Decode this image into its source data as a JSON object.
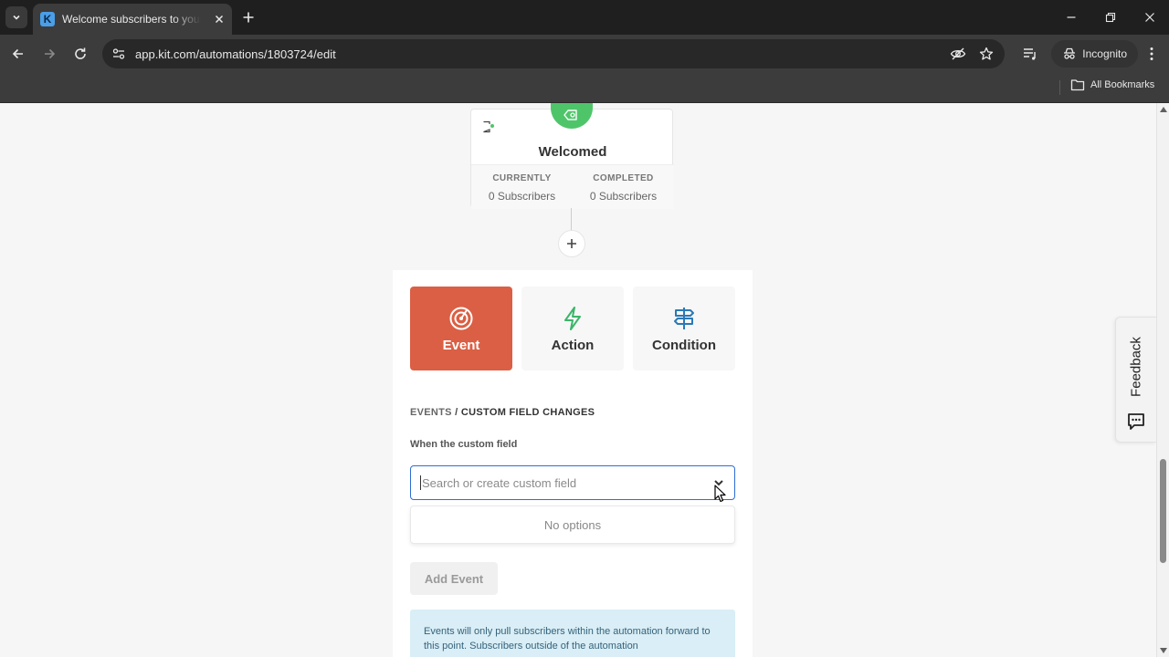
{
  "browser": {
    "tab_title": "Welcome subscribers to your p",
    "tab_favicon_letter": "K",
    "url": "app.kit.com/automations/1803724/edit",
    "incognito_label": "Incognito",
    "all_bookmarks_label": "All Bookmarks"
  },
  "step": {
    "title": "Welcomed",
    "currently_label": "CURRENTLY",
    "currently_value": "0 Subscribers",
    "completed_label": "COMPLETED",
    "completed_value": "0 Subscribers",
    "badge_color": "#4fc56a"
  },
  "types": {
    "event_label": "Event",
    "action_label": "Action",
    "condition_label": "Condition",
    "active_color": "#db5f44"
  },
  "form": {
    "breadcrumb_root": "EVENTS",
    "breadcrumb_sep": "/",
    "breadcrumb_current": "CUSTOM FIELD CHANGES",
    "field_label": "When the custom field",
    "search_placeholder": "Search or create custom field",
    "search_value": "",
    "no_options": "No options",
    "add_event_label": "Add Event",
    "info_text": "Events will only pull subscribers within the automation forward to this point. Subscribers outside of the automation"
  },
  "feedback": {
    "label": "Feedback"
  },
  "icons": {
    "event": "target-icon",
    "action": "lightning-icon",
    "condition": "signpost-icon"
  }
}
